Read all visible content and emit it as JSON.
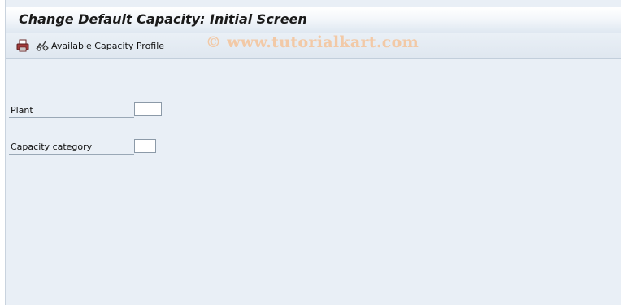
{
  "window": {
    "title": "Change Default Capacity: Initial Screen"
  },
  "toolbar": {
    "button_label": "Available Capacity Profile",
    "icons": [
      "printer-icon",
      "capacity-profile-icon"
    ]
  },
  "watermark": "© www.tutorialkart.com",
  "form": {
    "fields": [
      {
        "label": "Plant",
        "value": ""
      },
      {
        "label": "Capacity category",
        "value": ""
      }
    ]
  },
  "colors": {
    "background": "#e9eff6",
    "watermark": "#f2c9a6"
  }
}
